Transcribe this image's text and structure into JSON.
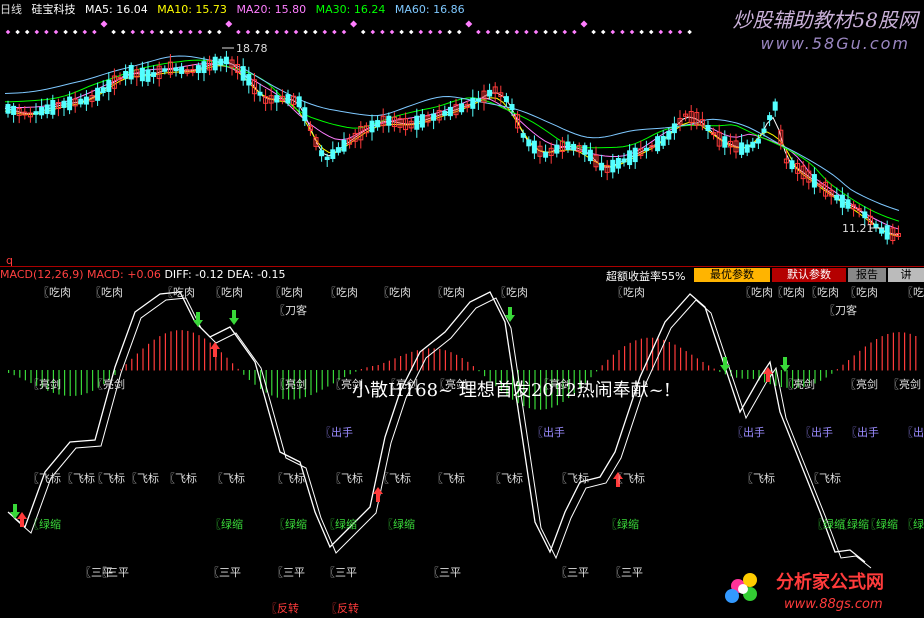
{
  "header": {
    "period": "日线",
    "stock_name": "硅宝科技",
    "ma5": "MA5: 16.04",
    "ma10": "MA10: 15.73",
    "ma20": "MA20: 15.80",
    "ma30": "MA30: 16.24",
    "ma60": "MA60: 16.86"
  },
  "colors": {
    "up": "#ff3b3b",
    "down": "#54ffff",
    "ma5": "#ffffff",
    "ma10": "#ffff00",
    "ma20": "#ff7eff",
    "ma30": "#00ff00",
    "ma60": "#7ec8ff",
    "signal_gray": "#dddddd",
    "signal_green": "#39d839",
    "signal_purple": "#9b8cff",
    "signal_red": "#ff3b3b"
  },
  "price_panel": {
    "high_label": "18.78",
    "low_label": "11.21",
    "corner_mark": "q"
  },
  "macd": {
    "title": "MACD(12,26,9)",
    "macd_value": "MACD: +0.06",
    "diff_value": "DIFF: -0.12",
    "dea_value": "DEA: -0.15",
    "excess_return": "超额收益率55%"
  },
  "buttons": {
    "best_params": "最优参数",
    "default_params": "默认参数",
    "report": "报告",
    "explain": "讲"
  },
  "signals": {
    "chirou": "〖吃肉",
    "daoke": "〖刀客",
    "liangjian": "〖亮剑",
    "chushou": "〖出手",
    "feibiao": "〖飞标",
    "lvsuo": "〖绿缩",
    "sanping": "〖三平",
    "fanzhuan": "〖反转"
  },
  "banner_text": "小散H168~ 理想首发2012热闹奉献~!",
  "watermark": {
    "title": "炒股辅助教材58股网",
    "url": "www.58Gu.com",
    "logo_title": "分析家公式网",
    "logo_url": "www.88gs.com"
  }
}
